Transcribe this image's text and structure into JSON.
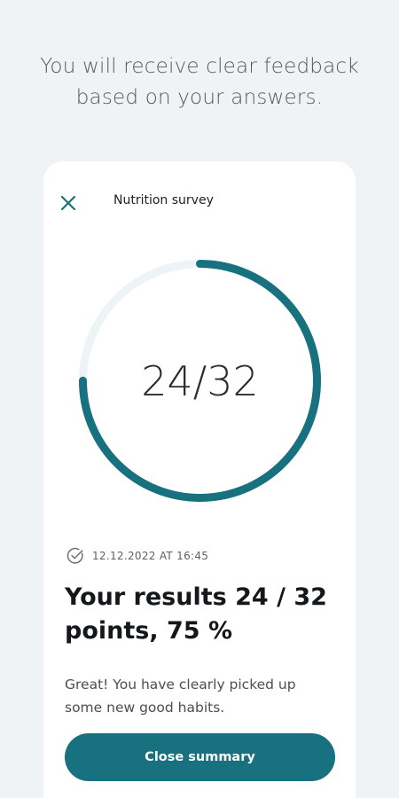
{
  "headline": {
    "line1": "You will receive clear feedback",
    "line2": "based on your answers."
  },
  "survey": {
    "title": "Nutrition survey",
    "close_icon": "close-icon",
    "score_text": "24/32",
    "score_value": 24,
    "score_max": 32,
    "accent_color": "#18717e",
    "track_color": "#eef3f6"
  },
  "result": {
    "date": "12.12.2022 AT 16:45",
    "date_icon": "check-circle-icon",
    "title_line1": "Your results 24 / 32",
    "title_line2": "points, 75 %",
    "text_line1": "Great! You have clearly picked up",
    "text_line2": "some new good habits."
  },
  "buttons": {
    "close_summary": "Close summary"
  }
}
